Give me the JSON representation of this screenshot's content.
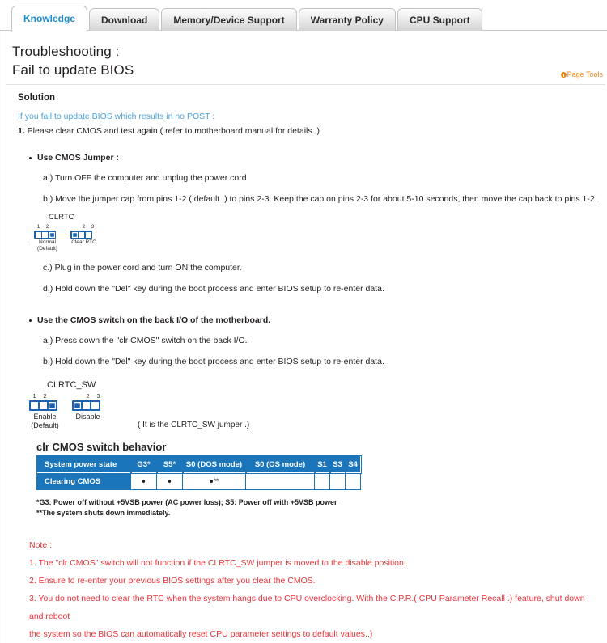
{
  "tabs": [
    {
      "label": "Knowledge",
      "active": true
    },
    {
      "label": "Download",
      "active": false
    },
    {
      "label": "Memory/Device Support",
      "active": false
    },
    {
      "label": "Warranty Policy",
      "active": false
    },
    {
      "label": "CPU Support",
      "active": false
    }
  ],
  "header": {
    "title_line1": "Troubleshooting :",
    "title_line2": "Fail to update BIOS",
    "page_tools": "Page Tools",
    "page_tools_icon": "bullet-circle-icon",
    "accent_orange": "#f08519"
  },
  "solution": {
    "heading": "Solution",
    "intro": "If you fail to update BIOS which results in no POST :",
    "intro_color": "#4aa3dd",
    "step1_num": "1.",
    "step1_text": " Please clear CMOS and test again ( refer to motherboard manual for details .)"
  },
  "section1": {
    "bullet": "Use CMOS Jumper :",
    "items": [
      "a.) Turn OFF the computer and unplug the power cord",
      "b.) Move the jumper cap from pins 1-2 ( default .) to pins 2-3. Keep the cap on pins 2-3 for about 5-10 seconds, then move the cap back to pins 1-2.",
      "c.) Plug in the power cord and turn ON the computer.",
      "d.) Hold down the \"Del\" key during the boot process and enter BIOS setup to re-enter data."
    ],
    "figure": {
      "title": "CLRTC",
      "block_left": {
        "pins": "1  2",
        "pin_left": "1",
        "pin_right": "2",
        "caption_line1": "Normal",
        "caption_line2": "(Default)"
      },
      "block_right": {
        "pin_left": "2",
        "pin_right": "3",
        "caption_line1": "Clear RTC",
        "caption_line2": ""
      }
    }
  },
  "section2": {
    "bullet": "Use the CMOS switch on the back I/O of the motherboard.",
    "items": [
      "a.) Press down the \"clr CMOS\" switch on the back I/O.",
      "b.) Hold down the \"Del\" key during the boot process and enter BIOS setup to re-enter data."
    ],
    "figure": {
      "title": "CLRTC_SW",
      "block_left": {
        "pin_left": "1",
        "pin_right": "2",
        "caption_line1": "Enable",
        "caption_line2": "(Default)"
      },
      "block_right": {
        "pin_left": "2",
        "pin_right": "3",
        "caption_line1": "Disable",
        "caption_line2": ""
      },
      "note": "( It is the CLRTC_SW jumper .)"
    }
  },
  "table": {
    "title": "clr CMOS switch behavior",
    "accent_blue": "#1b75bb",
    "headers": [
      "System power state",
      "G3*",
      "S5*",
      "S0 (DOS mode)",
      "S0 (OS mode)",
      "S1",
      "S3",
      "S4"
    ],
    "row_label": "Clearing CMOS",
    "cells": [
      "dot",
      "dot",
      "dot-double-asterisk",
      "",
      "",
      "",
      ""
    ],
    "footnotes": [
      "*G3: Power off without +5VSB power (AC power loss); S5: Power off with +5VSB power",
      "**The system shuts down immediately."
    ]
  },
  "notes": {
    "color": "#e8343a",
    "heading": "Note :",
    "lines": [
      "1. The \"clr CMOS\" switch will not function if the CLRTC_SW jumper is moved to the disable position.",
      "2. Ensure to re-enter your previous BIOS settings after you clear the CMOS.",
      "3. You do not need to clear the RTC when the system hangs due to CPU overclocking. With the C.P.R.( CPU Parameter Recall .) feature, shut down and reboot",
      "the system so the BIOS can automatically reset CPU parameter settings to default values..)"
    ]
  }
}
